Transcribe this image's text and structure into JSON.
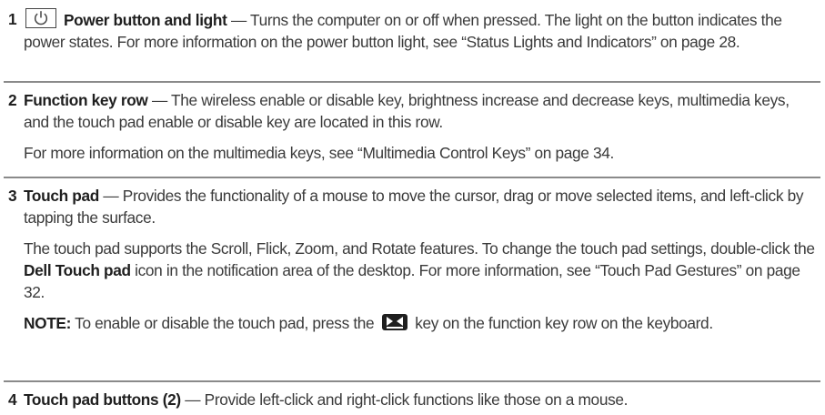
{
  "items": [
    {
      "number": "1",
      "term": "Power button and light",
      "description": "Turns the computer on or off when pressed. The light on the button indicates the power states. For more information on the power button light, see “Status Lights and Indicators” on page 28."
    },
    {
      "number": "2",
      "term": "Function key row",
      "description": "The wireless enable or disable key, brightness increase and decrease keys, multimedia keys, and the touch pad enable or disable key are located in this row.",
      "extra": "For more information on the multimedia keys, see “Multimedia Control Keys” on page 34."
    },
    {
      "number": "3",
      "term": "Touch pad",
      "description": "Provides the functionality of a mouse to move the cursor, drag or move selected items, and left-click by tapping the surface.",
      "extra_before": "The touch pad supports the Scroll, Flick, Zoom, and Rotate features. To change the touch pad settings, double-click the ",
      "extra_bold": "Dell Touch pad",
      "extra_after": " icon in the notification area of the desktop. For more information, see “Touch Pad Gestures” on page 32.",
      "note_label": "NOTE:",
      "note_before": " To enable or disable the touch pad, press the ",
      "note_after": " key on the function key row on the keyboard."
    },
    {
      "number": "4",
      "term": "Touch pad buttons (2)",
      "description": "Provide left-click and right-click functions like those on a mouse."
    }
  ],
  "separator": "—",
  "icons": {
    "power": "power-icon",
    "touchpad_toggle_key": "touchpad-toggle-key-icon"
  },
  "colors": {
    "text": "#3a3a3a",
    "bold": "#1f1f1f",
    "rule": "#8a8a8a"
  }
}
